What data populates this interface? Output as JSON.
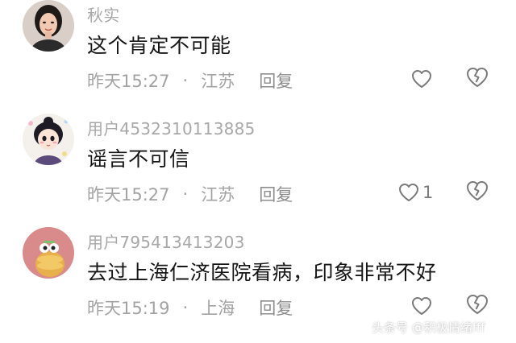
{
  "comments": [
    {
      "username": "秋实",
      "text": "这个肯定不可能",
      "time": "昨天15:27",
      "separator": "·",
      "location": "江苏",
      "reply_label": "回复",
      "like_count": "",
      "avatar_icon": "woman-portrait-avatar"
    },
    {
      "username": "用户4532310113885",
      "text": "谣言不可信",
      "time": "昨天15:27",
      "separator": "·",
      "location": "江苏",
      "reply_label": "回复",
      "like_count": "1",
      "avatar_icon": "cartoon-girl-avatar"
    },
    {
      "username": "用户795413413203",
      "text": "去过上海仁济医院看病，印象非常不好",
      "time": "昨天15:19",
      "separator": "·",
      "location": "上海",
      "reply_label": "回复",
      "like_count": "",
      "avatar_icon": "cartoon-character-avatar"
    }
  ],
  "watermark": "头条号 @积极情绪fff",
  "colors": {
    "username": "#a8a8a8",
    "text": "#161616",
    "meta": "#a3a3a3",
    "icon": "#7a7a7a"
  }
}
